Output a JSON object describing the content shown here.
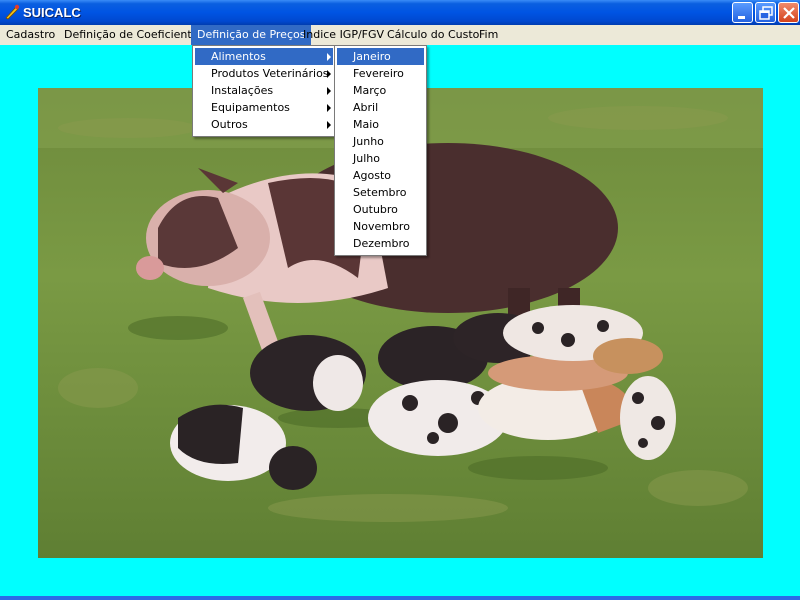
{
  "window": {
    "title": "SUICALC"
  },
  "menubar": {
    "items": [
      "Cadastro",
      "Definição de Coeficientes",
      "Definição de Preços",
      "Indice IGP/FGV",
      "Cálculo do Custo",
      "Fim"
    ],
    "active_index": 2
  },
  "submenu": {
    "items": [
      "Alimentos",
      "Produtos Veterinários",
      "Instalações",
      "Equipamentos",
      "Outros"
    ],
    "highlighted_index": 0
  },
  "months_menu": {
    "items": [
      "Janeiro",
      "Fevereiro",
      "Março",
      "Abril",
      "Maio",
      "Junho",
      "Julho",
      "Agosto",
      "Setembro",
      "Outubro",
      "Novembro",
      "Dezembro"
    ],
    "highlighted_index": 0
  },
  "icons": {
    "app": "suicalc-app-icon",
    "minimize": "minimize-icon",
    "restore": "restore-icon",
    "close": "close-icon",
    "submenu_arrow": "submenu-arrow-icon"
  },
  "colors": {
    "background": "#00ffff",
    "menu_highlight": "#316ac5",
    "titlebar": "#0054e3"
  }
}
